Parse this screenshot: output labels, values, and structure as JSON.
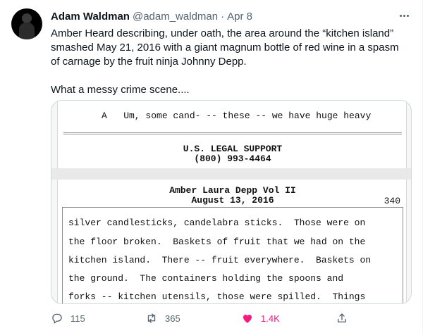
{
  "tweet": {
    "author_name": "Adam Waldman",
    "author_handle": "@adam_waldman",
    "separator": "·",
    "date": "Apr 8",
    "body": "Amber Heard describing, under oath, the area around the “kitchen island” smashed May 21, 2016 with a giant magnum bottle of red wine in a spasm of carnage by the fruit ninja Johnny Depp.\n\nWhat a messy crime scene...."
  },
  "media": {
    "top_line": "A   Um, some cand- -- these -- we have huge heavy",
    "firm_name": "U.S. LEGAL SUPPORT",
    "firm_phone": "(800) 993-4464",
    "deposition_title": "Amber Laura Depp Vol II",
    "deposition_date": "August 13, 2016",
    "page_number": "340",
    "lines": [
      "silver candlesticks, candelabra sticks.  Those were on",
      "the floor broken.  Baskets of fruit that we had on the",
      "kitchen island.  There -- fruit everywhere.  Baskets on",
      "the ground.  The containers holding the spoons and",
      "forks -- kitchen utensils, those were spilled.  Things"
    ]
  },
  "actions": {
    "reply_count": "115",
    "retweet_count": "365",
    "like_count": "1.4K"
  },
  "icons": {
    "more": "more-icon",
    "reply": "reply-icon",
    "retweet": "retweet-icon",
    "like": "heart-icon",
    "share": "share-icon"
  },
  "colors": {
    "like": "#f91880",
    "secondary_text": "#536471"
  }
}
